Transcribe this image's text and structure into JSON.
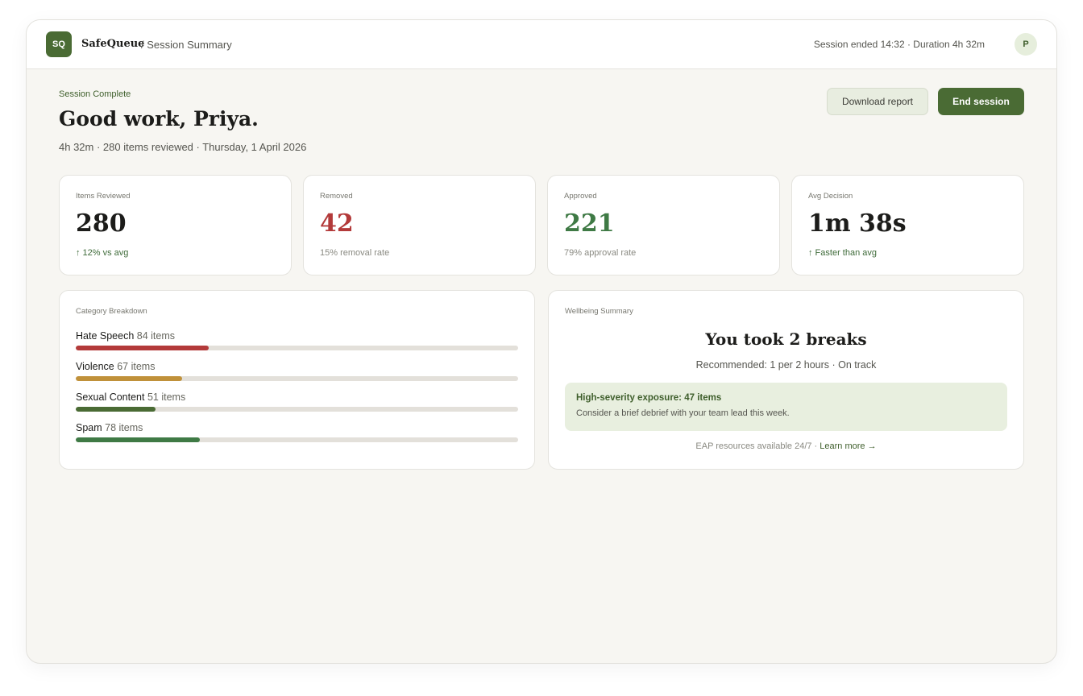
{
  "header": {
    "logo": "SQ",
    "brand": "SafeQueue",
    "breadcrumb": "/ Session Summary",
    "session_info": "Session ended 14:32 · Duration 4h 32m",
    "avatar": "P"
  },
  "hero": {
    "eyebrow": "Session Complete",
    "greeting": "Good work, Priya.",
    "subline": "4h 32m · 280 items reviewed · Thursday, 1 April 2026"
  },
  "actions": {
    "download_label": "Download report",
    "end_label": "End session"
  },
  "stats": [
    {
      "label": "Items Reviewed",
      "value": "280",
      "sub": "↑ 12% vs avg"
    },
    {
      "label": "Removed",
      "value": "42",
      "sub": "15% removal rate"
    },
    {
      "label": "Approved",
      "value": "221",
      "sub": "79% approval rate"
    },
    {
      "label": "Avg Decision",
      "value": "1m 38s",
      "sub": "↑ Faster than avg"
    }
  ],
  "categories": {
    "label": "Category Breakdown",
    "items": [
      {
        "name": "Hate Speech",
        "count": "84 items",
        "fill": 0.3,
        "color": "#b33a3a"
      },
      {
        "name": "Violence",
        "count": "67 items",
        "fill": 0.24,
        "color": "#c0913a"
      },
      {
        "name": "Sexual Content",
        "count": "51 items",
        "fill": 0.18,
        "color": "#4a6b34"
      },
      {
        "name": "Spam",
        "count": "78 items",
        "fill": 0.28,
        "color": "#3f7a45"
      }
    ]
  },
  "wellbeing": {
    "label": "Wellbeing Summary",
    "breaks_title": "You took 2 breaks",
    "breaks_sub": "Recommended: 1 per 2 hours · On track",
    "alert_title": "High-severity exposure: 47 items",
    "alert_body": "Consider a brief debrief with your team lead this week.",
    "eap_text": "EAP resources available 24/7 · ",
    "learn_more": "Learn more →"
  }
}
